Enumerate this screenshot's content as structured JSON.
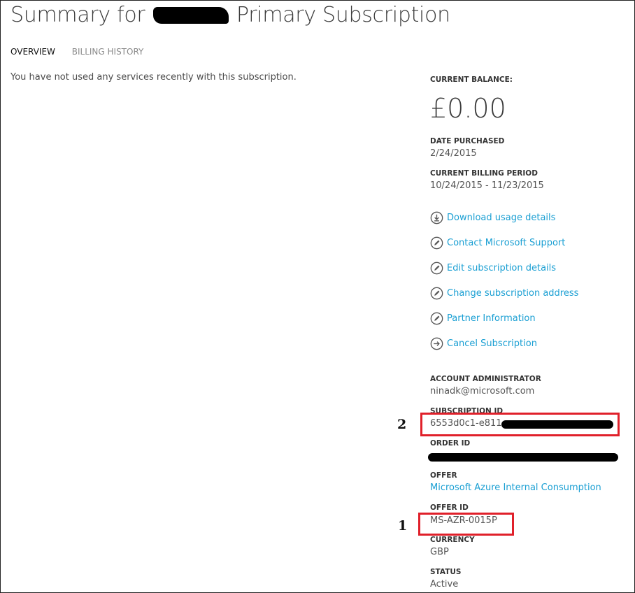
{
  "header": {
    "title_prefix": "Summary for",
    "title_suffix": "Primary Subscription"
  },
  "tabs": [
    {
      "label": "OVERVIEW",
      "active": true
    },
    {
      "label": "BILLING HISTORY",
      "active": false
    }
  ],
  "main": {
    "no_usage_text": "You have not used any services recently with this subscription."
  },
  "summary": {
    "balance_label": "CURRENT BALANCE:",
    "balance_value": "£0.00",
    "date_purchased_label": "DATE PURCHASED",
    "date_purchased_value": "2/24/2015",
    "billing_period_label": "CURRENT BILLING PERIOD",
    "billing_period_value": "10/24/2015 - 11/23/2015"
  },
  "actions": [
    {
      "label": "Download usage details",
      "icon": "download-icon"
    },
    {
      "label": "Contact Microsoft Support",
      "icon": "pencil-icon"
    },
    {
      "label": "Edit subscription details",
      "icon": "pencil-icon"
    },
    {
      "label": "Change subscription address",
      "icon": "pencil-icon"
    },
    {
      "label": "Partner Information",
      "icon": "pencil-icon"
    },
    {
      "label": "Cancel Subscription",
      "icon": "arrow-right-icon"
    }
  ],
  "details": {
    "admin_label": "ACCOUNT ADMINISTRATOR",
    "admin_value": "ninadk@microsoft.com",
    "subscription_id_label": "SUBSCRIPTION ID",
    "subscription_id_value": "6553d0c1-e811",
    "order_id_label": "ORDER ID",
    "offer_label": "OFFER",
    "offer_value": "Microsoft Azure Internal Consumption",
    "offer_id_label": "OFFER ID",
    "offer_id_value": "MS-AZR-0015P",
    "currency_label": "CURRENCY",
    "currency_value": "GBP",
    "status_label": "STATUS",
    "status_value": "Active"
  },
  "annotations": {
    "marker_1": "1",
    "marker_2": "2",
    "highlight_color": "#e0202a"
  },
  "colors": {
    "link": "#1a9fd3",
    "text": "#444444"
  }
}
